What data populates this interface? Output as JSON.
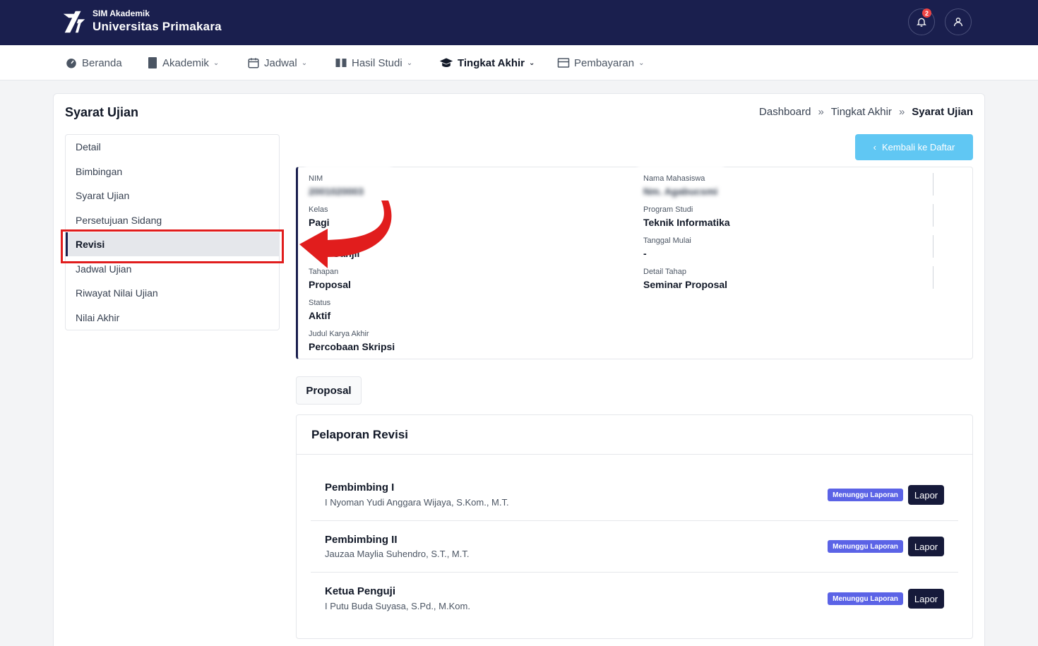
{
  "header": {
    "brand_small": "SIM Akademik",
    "brand_title": "Universitas Primakara",
    "notification_count": "2"
  },
  "nav": [
    {
      "label": "Beranda",
      "icon": "dashboard-icon"
    },
    {
      "label": "Akademik",
      "icon": "book-icon"
    },
    {
      "label": "Jadwal",
      "icon": "calendar-icon"
    },
    {
      "label": "Hasil Studi",
      "icon": "open-book-icon"
    },
    {
      "label": "Tingkat Akhir",
      "icon": "graduation-cap-icon"
    },
    {
      "label": "Pembayaran",
      "icon": "card-icon"
    }
  ],
  "page": {
    "title": "Syarat Ujian",
    "breadcrumb": [
      "Dashboard",
      "Tingkat Akhir",
      "Syarat Ujian"
    ],
    "breadcrumb_sep": "»",
    "back_label": "Kembali ke Daftar"
  },
  "sidebar": {
    "items": [
      {
        "label": "Detail"
      },
      {
        "label": "Bimbingan"
      },
      {
        "label": "Syarat Ujian"
      },
      {
        "label": "Persetujuan Sidang"
      },
      {
        "label": "Revisi"
      },
      {
        "label": "Jadwal Ujian"
      },
      {
        "label": "Riwayat Nilai Ujian"
      },
      {
        "label": "Nilai Akhir"
      }
    ],
    "active_index": 4
  },
  "info": {
    "nim_label": "NIM",
    "nim_value": "2001020003",
    "nama_label": "Nama Mahasiswa",
    "nama_value": "Nm. Agabucsmi",
    "kelas_label": "Kelas",
    "kelas_value": "Pagi",
    "prodi_label": "Program Studi",
    "prodi_value": "Teknik Informatika",
    "semester_value": "- Ganjil",
    "tanggal_label": "Tanggal Mulai",
    "tanggal_value": "-",
    "tahapan_label": "Tahapan",
    "tahapan_value": "Proposal",
    "detail_tahap_label": "Detail Tahap",
    "detail_tahap_value": "Seminar Proposal",
    "status_label": "Status",
    "status_value": "Aktif",
    "judul_label": "Judul Karya Akhir",
    "judul_value": "Percobaan Skripsi"
  },
  "tab": {
    "label": "Proposal"
  },
  "revisi": {
    "title": "Pelaporan Revisi",
    "rows": [
      {
        "role": "Pembimbing I",
        "name": "I Nyoman Yudi Anggara Wijaya, S.Kom., M.T.",
        "status": "Menunggu Laporan",
        "action": "Lapor"
      },
      {
        "role": "Pembimbing II",
        "name": "Jauzaa Maylia Suhendro, S.T., M.T.",
        "status": "Menunggu Laporan",
        "action": "Lapor"
      },
      {
        "role": "Ketua Penguji",
        "name": "I Putu Buda Suyasa, S.Pd., M.Kom.",
        "status": "Menunggu Laporan",
        "action": "Lapor"
      }
    ]
  },
  "colors": {
    "navy": "#1a1f4e",
    "accent_blue": "#60c7f3",
    "badge": "#5b63e6",
    "highlight_red": "#e11d1d"
  }
}
